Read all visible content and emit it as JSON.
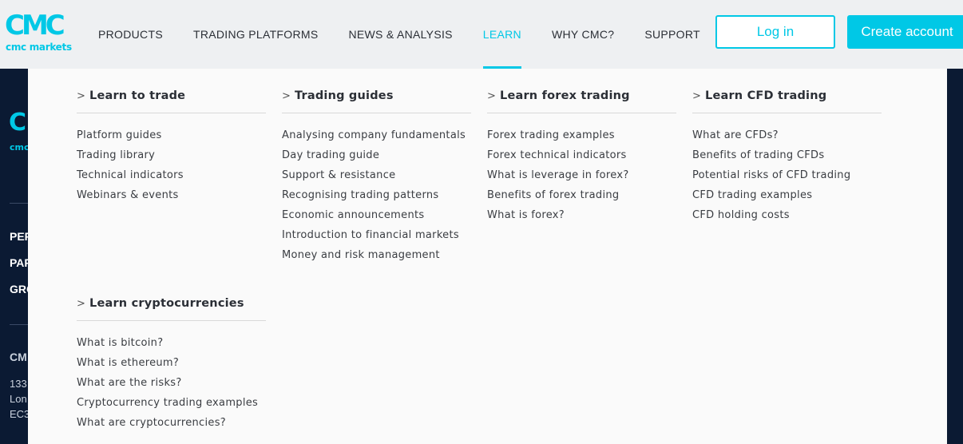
{
  "header": {
    "logo": {
      "mark": "CMC",
      "wordmark": "cmc markets"
    },
    "nav": [
      {
        "label": "PRODUCTS",
        "active": false
      },
      {
        "label": "TRADING PLATFORMS",
        "active": false
      },
      {
        "label": "NEWS & ANALYSIS",
        "active": false
      },
      {
        "label": "LEARN",
        "active": true
      },
      {
        "label": "WHY CMC?",
        "active": false
      },
      {
        "label": "SUPPORT",
        "active": false
      }
    ],
    "login_label": "Log in",
    "create_label": "Create account"
  },
  "background_footer": {
    "logo_mark": "C",
    "logo_word": "cmc",
    "links": [
      "PER",
      "PAR",
      "GRO"
    ],
    "company": "CM",
    "address": [
      "133",
      "Lon",
      "EC3"
    ]
  },
  "menu": {
    "columns": [
      {
        "heading": "Learn to trade",
        "items": [
          "Platform guides",
          "Trading library",
          "Technical indicators",
          "Webinars & events"
        ]
      },
      {
        "heading": "Trading guides",
        "items": [
          "Analysing company fundamentals",
          "Day trading guide",
          "Support & resistance",
          "Recognising trading patterns",
          "Economic announcements",
          "Introduction to financial markets",
          "Money and risk management"
        ]
      },
      {
        "heading": "Learn forex trading",
        "items": [
          "Forex trading examples",
          "Forex technical indicators",
          "What is leverage in forex?",
          "Benefits of forex trading",
          "What is forex?"
        ]
      },
      {
        "heading": "Learn CFD trading",
        "items": [
          "What are CFDs?",
          "Benefits of trading CFDs",
          "Potential risks of CFD trading",
          "CFD trading examples",
          "CFD holding costs"
        ]
      },
      {
        "heading": "Learn cryptocurrencies",
        "items": [
          "What is bitcoin?",
          "What is ethereum?",
          "What are the risks?",
          "Cryptocurrency trading examples",
          "What are cryptocurrencies?"
        ]
      }
    ]
  },
  "colors": {
    "accent": "#00c8e6",
    "footer_bg": "#0b1a33",
    "header_bg": "#eef0f2",
    "panel_bg": "#fafafa"
  }
}
